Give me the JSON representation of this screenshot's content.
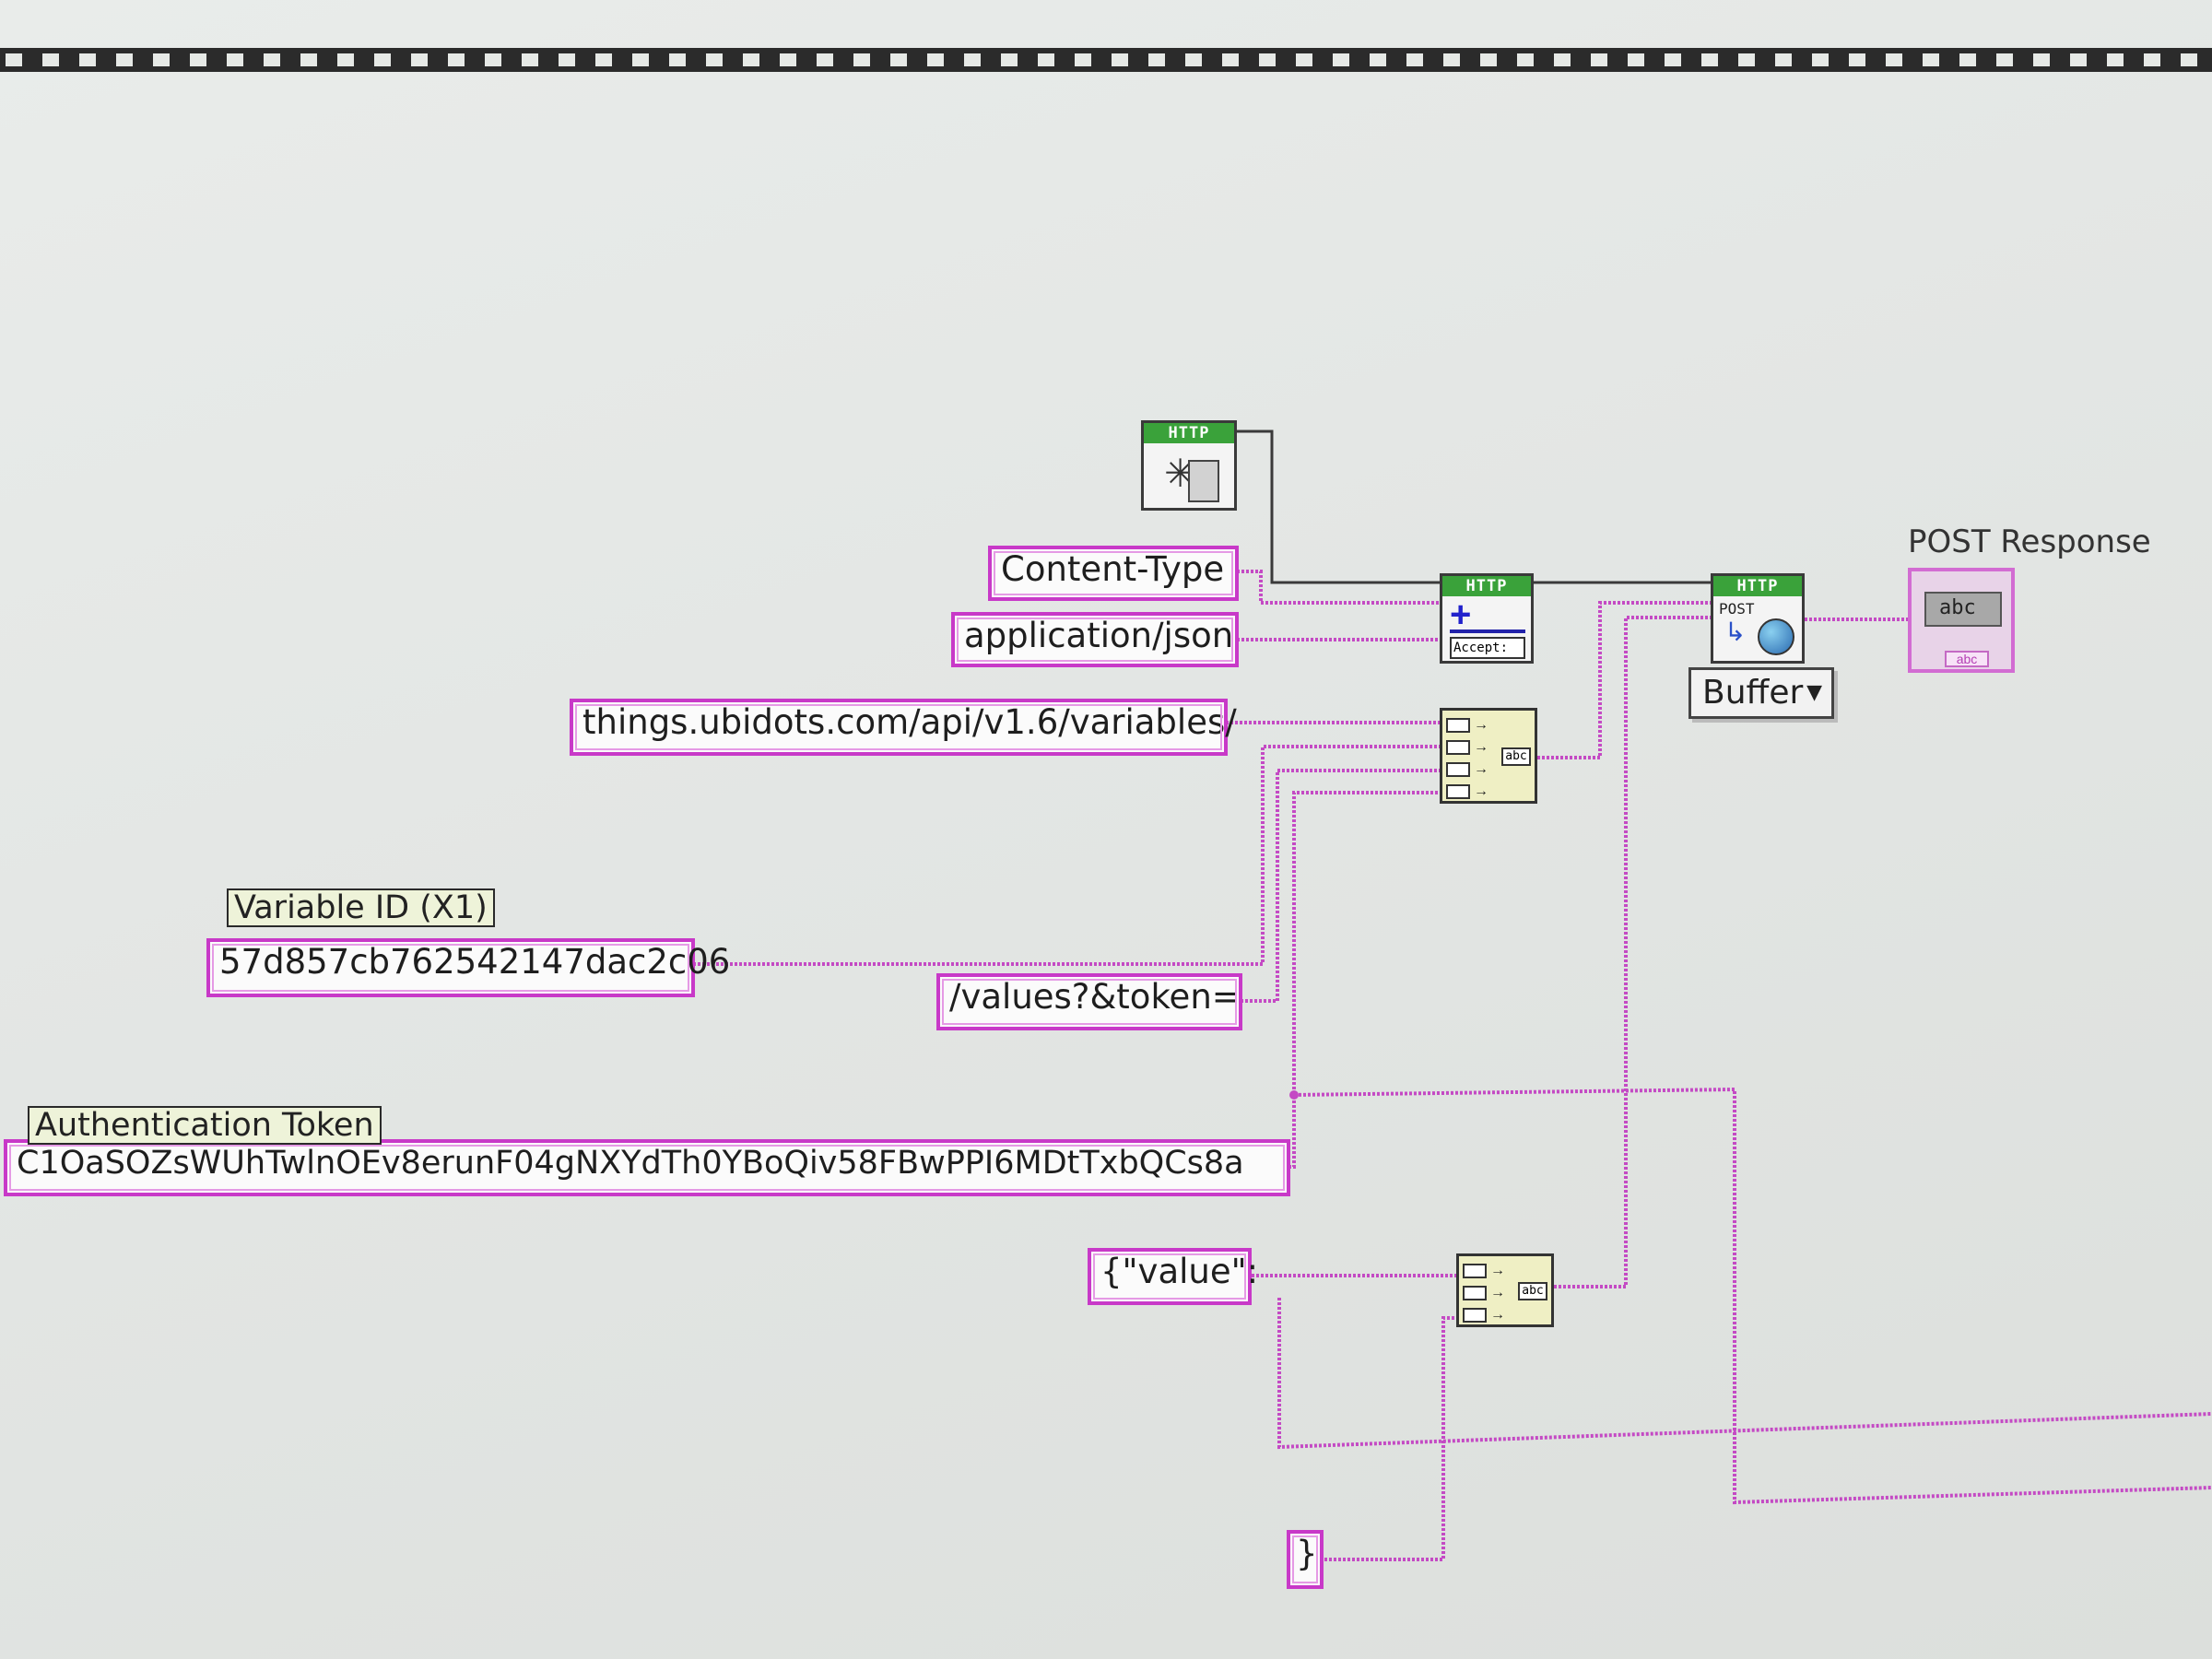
{
  "diagram": {
    "constants": {
      "content_type": "Content-Type",
      "application_json": "application/json",
      "base_url": "things.ubidots.com/api/v1.6/variables/",
      "variable_id": "57d857cb762542147dac2c06",
      "values_token": "/values?&token=",
      "auth_token": "C1OaSOZsWUhTwlnOEv8erunF04gNXYdTh0YBoQiv58FBwPPI6MDtTxbQCs8a",
      "value_open": "{\"value\":",
      "close_brace": "}"
    },
    "labels": {
      "variable_id": "Variable ID (X1)",
      "auth_token": "Authentication Token",
      "post_response": "POST Response"
    },
    "nodes": {
      "http_open": "HTTP",
      "http_header": "HTTP",
      "header_sublabel": "Accept:",
      "http_post": "HTTP",
      "post_sublabel": "POST"
    },
    "concat_output": "abc",
    "buffer_select": "Buffer",
    "indicator_value": "abc",
    "indicator_tag": "abc"
  },
  "colors": {
    "string_wire": "#c44ac4",
    "reference_wire": "#3a3a3a",
    "http_band": "#3aa23a"
  }
}
